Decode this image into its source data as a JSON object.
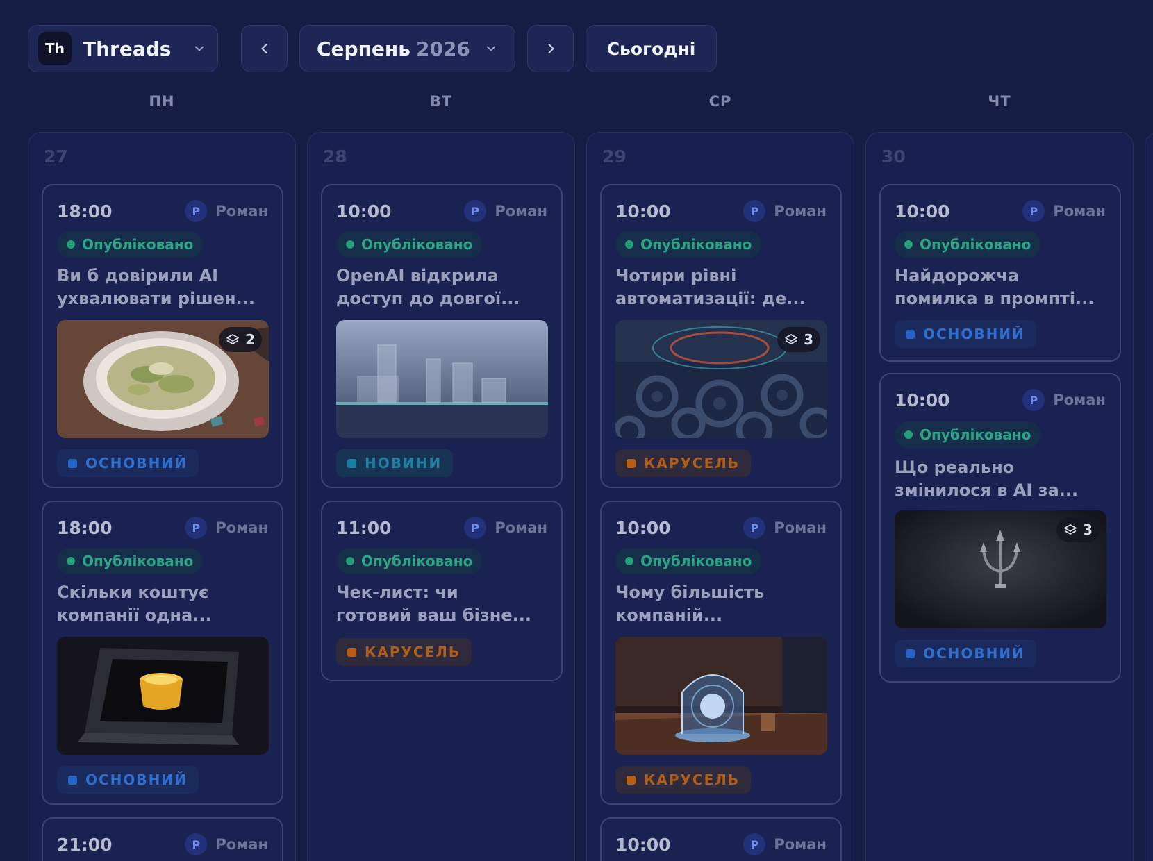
{
  "header": {
    "account_initials": "Th",
    "account_name": "Threads",
    "month": "Серпень",
    "year": "2026",
    "today_label": "Сьогодні"
  },
  "weekdays": [
    "ПН",
    "ВТ",
    "СР",
    "ЧТ"
  ],
  "days": [
    {
      "number": "27",
      "posts": [
        {
          "time": "18:00",
          "author_initial": "Р",
          "author": "Роман",
          "status": "Опубліковано",
          "title_line1": "Ви б довірили AI",
          "title_line2": "ухвалювати рішен...",
          "image": "salad-bowl",
          "count": "2",
          "tag": "ОСНОВНИЙ"
        },
        {
          "time": "18:00",
          "author_initial": "Р",
          "author": "Роман",
          "status": "Опубліковано",
          "title_line1": "Скільки коштує",
          "title_line2": "компанії одна...",
          "image": "drink-frame",
          "tag": "ОСНОВНИЙ"
        },
        {
          "time": "21:00",
          "author_initial": "Р",
          "author": "Роман"
        }
      ]
    },
    {
      "number": "28",
      "posts": [
        {
          "time": "10:00",
          "author_initial": "Р",
          "author": "Роман",
          "status": "Опубліковано",
          "title_line1": "OpenAI відкрила",
          "title_line2": "доступ до довгої...",
          "image": "glass-bars",
          "tag": "НОВИНИ"
        },
        {
          "time": "11:00",
          "author_initial": "Р",
          "author": "Роман",
          "status": "Опубліковано",
          "title_line1": "Чек-лист: чи",
          "title_line2": "готовий ваш бізне...",
          "tag": "КАРУСЕЛЬ"
        }
      ]
    },
    {
      "number": "29",
      "posts": [
        {
          "time": "10:00",
          "author_initial": "Р",
          "author": "Роман",
          "status": "Опубліковано",
          "title_line1": "Чотири рівні",
          "title_line2": "автоматизації: де...",
          "image": "gears",
          "count": "3",
          "tag": "КАРУСЕЛЬ"
        },
        {
          "time": "10:00",
          "author_initial": "Р",
          "author": "Роман",
          "status": "Опубліковано",
          "title_line1": "Чому більшість",
          "title_line2": "компаній...",
          "image": "glass-dome",
          "tag": "КАРУСЕЛЬ"
        },
        {
          "time": "10:00",
          "author_initial": "Р",
          "author": "Роман"
        }
      ]
    },
    {
      "number": "30",
      "posts": [
        {
          "time": "10:00",
          "author_initial": "Р",
          "author": "Роман",
          "status": "Опубліковано",
          "title_line1": "Найдорожча",
          "title_line2": "помилка в промпті...",
          "tag": "ОСНОВНИЙ"
        },
        {
          "time": "10:00",
          "author_initial": "Р",
          "author": "Роман",
          "status": "Опубліковано",
          "title_line1": "Що реально",
          "title_line2": "змінилося в AI за...",
          "image": "trident-logo",
          "count": "3",
          "tag": "ОСНОВНИЙ"
        }
      ]
    }
  ],
  "colors": {
    "background": "#161d45",
    "published": "#23a17a",
    "tag_main": "#2563c9",
    "tag_news": "#1680a3",
    "tag_carousel": "#b85e14"
  }
}
